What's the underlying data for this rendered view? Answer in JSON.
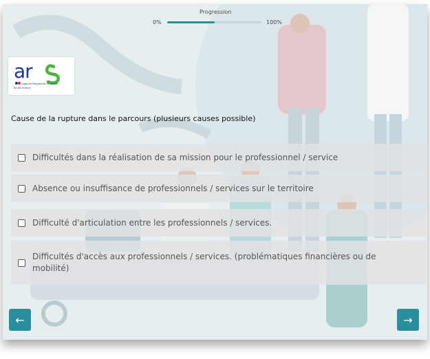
{
  "progress": {
    "label": "Progression",
    "min_label": "0%",
    "max_label": "100%",
    "value_fraction": 0.5
  },
  "logo": {
    "brand": "ars",
    "line1": "Agence Régionale de Santé",
    "line2": "Île-de-France",
    "brand_color": "#1d3a8a",
    "accent_color": "#49b63a"
  },
  "question": {
    "title": "Cause de la rupture dans le parcours (plusieurs causes possible)"
  },
  "options": [
    {
      "label": "Difficultés dans la réalisation de sa mission pour le professionnel / service",
      "checked": false
    },
    {
      "label": "Absence ou insuffisance de professionnels / services sur le territoire",
      "checked": false
    },
    {
      "label": "Difficulté d'articulation entre les professionnels / services.",
      "checked": false
    },
    {
      "label": "Difficultés d'accès aux professionnels / services. (problématiques financières ou de mobilité)",
      "checked": false
    }
  ],
  "navigation": {
    "prev_icon": "←",
    "next_icon": "→",
    "accent": "#2a8f9c"
  }
}
